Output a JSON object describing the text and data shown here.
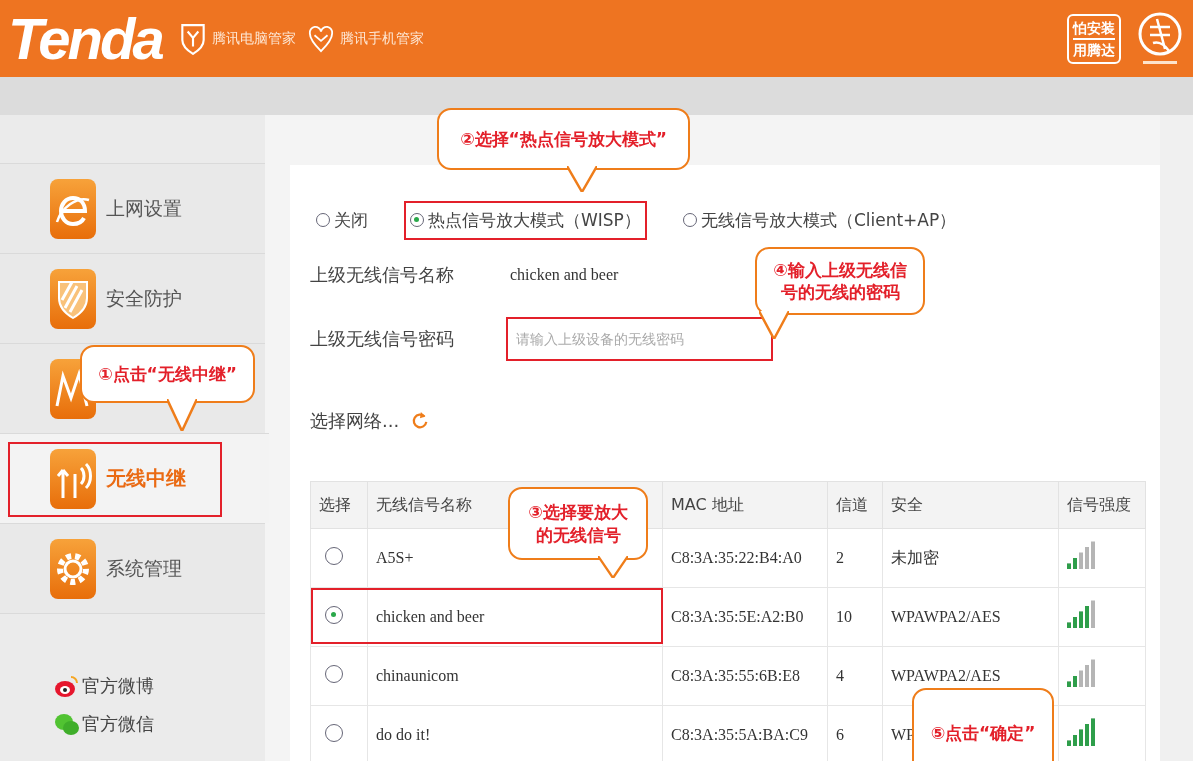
{
  "header": {
    "logo": "Tenda",
    "partners": [
      {
        "kind": "shield",
        "label": "腾讯电脑管家"
      },
      {
        "kind": "heart",
        "label": "腾讯手机管家"
      }
    ],
    "badge": [
      "怕安装",
      "用腾达"
    ]
  },
  "sidebar": {
    "items": [
      {
        "kind": "browser",
        "label": "上网设置",
        "selected": false,
        "highlighted": false
      },
      {
        "kind": "shield",
        "label": "安全防护",
        "selected": false,
        "highlighted": false
      },
      {
        "kind": "wave",
        "selected": false,
        "highlighted": false
      },
      {
        "kind": "antenna",
        "label": "无线中继",
        "selected": true,
        "highlighted": true
      },
      {
        "kind": "gear",
        "label": "系统管理",
        "selected": false,
        "highlighted": false
      }
    ],
    "links": [
      {
        "kind": "weibo",
        "label": "官方微博"
      },
      {
        "kind": "wechat",
        "label": "官方微信"
      }
    ]
  },
  "mode_options": [
    {
      "label": "关闭",
      "selected": false,
      "highlighted": false
    },
    {
      "label": "热点信号放大模式（WISP）",
      "selected": true,
      "highlighted": true
    },
    {
      "label": "无线信号放大模式（Client+AP）",
      "selected": false,
      "highlighted": false
    }
  ],
  "upstream_name": {
    "label": "上级无线信号名称",
    "value": "chicken and beer"
  },
  "upstream_password": {
    "label": "上级无线信号密码",
    "placeholder": "请输入上级设备的无线密码",
    "highlighted": true
  },
  "select_network": "选择网络...",
  "table": {
    "columns": [
      "选择",
      "无线信号名称",
      "MAC 地址",
      "信道",
      "安全",
      "信号强度"
    ],
    "rows": [
      {
        "selected": false,
        "highlighted": false,
        "ssid": "A5S+",
        "mac": "C8:3A:35:22:B4:A0",
        "channel": "2",
        "security": "未加密",
        "level": 0.4
      },
      {
        "selected": true,
        "highlighted": true,
        "ssid": "chicken and beer",
        "mac": "C8:3A:35:5E:A2:B0",
        "channel": "10",
        "security": "WPAWPA2/AES",
        "level": 0.8
      },
      {
        "selected": false,
        "highlighted": false,
        "ssid": "chinaunicom",
        "mac": "C8:3A:35:55:6B:E8",
        "channel": "4",
        "security": "WPAWPA2/AES",
        "level": 0.4
      },
      {
        "selected": false,
        "highlighted": false,
        "ssid": "do do it!",
        "mac": "C8:3A:35:5A:BA:C9",
        "channel": "6",
        "security": "WP",
        "level": 1
      }
    ]
  },
  "callouts": [
    {
      "text": "①点击“无线中继”"
    },
    {
      "text": "②选择“热点信号放大模式”"
    },
    {
      "text": "④输入上级无线信号的无线的密码"
    },
    {
      "text": "③选择要放大的无线信号"
    },
    {
      "text": "⑤点击“确定”"
    }
  ]
}
